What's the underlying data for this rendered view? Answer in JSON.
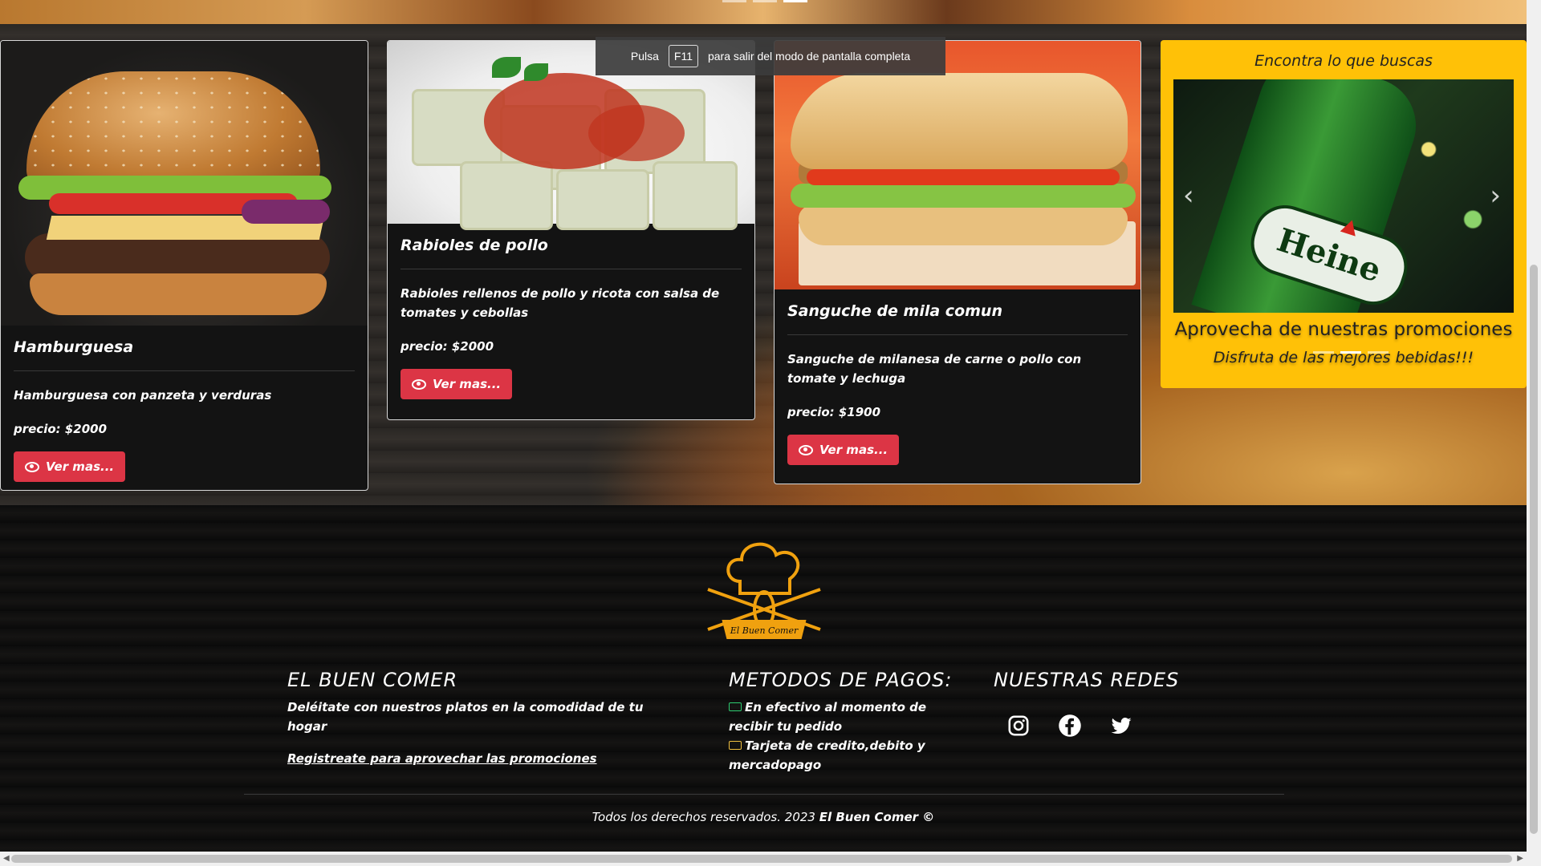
{
  "fullscreen_hint": {
    "press": "Pulsa",
    "key": "F11",
    "rest": "para salir del modo de pantalla completa"
  },
  "cards": [
    {
      "title": "Hamburguesa",
      "description": "Hamburguesa con panzeta y verduras",
      "price": "precio: $2000",
      "button": "Ver mas..."
    },
    {
      "title": "Rabioles de pollo",
      "description": "Rabioles rellenos de pollo y ricota con salsa de tomates y cebollas",
      "price": "precio: $2000",
      "button": "Ver mas..."
    },
    {
      "title": "Sanguche de mila comun",
      "description": "Sanguche de milanesa de carne o pollo con tomate y lechuga",
      "price": "precio: $1900",
      "button": "Ver mas..."
    }
  ],
  "promo": {
    "title": "Encontra lo que buscas",
    "bottle_label": "Heine",
    "caption_title": "Aprovecha de nuestras promociones",
    "caption_text": "Disfruta de las mejores bebidas!!!",
    "prev": "‹",
    "next": "›"
  },
  "footer": {
    "brand_title": "EL BUEN COMER",
    "brand_text": "Deléitate con nuestros platos en la comodidad de tu hogar",
    "register_link": "Registreate para aprovechar las promociones",
    "payments_title": "METODOS DE PAGOS:",
    "payment_cash": "En efectivo al momento de recibir tu pedido",
    "payment_card": "Tarjeta de credito,debito y mercadopago",
    "social_title": "NUESTRAS REDES",
    "copyright": "Todos los derechos reservados. 2023",
    "copyright_brand": "El Buen Comer ©",
    "logo_text": "El Buen Comer"
  },
  "colors": {
    "accent": "#ffc107",
    "button": "#dc3545"
  }
}
